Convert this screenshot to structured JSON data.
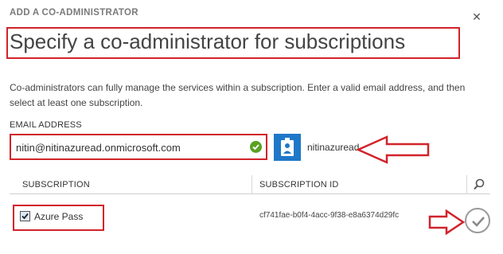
{
  "dialog": {
    "label": "ADD A CO-ADMINISTRATOR",
    "close_glyph": "✕",
    "title": "Specify a co-administrator for subscriptions",
    "description": "Co-administrators can fully manage the services within a subscription. Enter a valid email address, and then select at least one subscription."
  },
  "email": {
    "label": "EMAIL ADDRESS",
    "value": "nitin@nitinazuread.onmicrosoft.com",
    "valid_icon": "check-circle-icon",
    "resolved_user_name": "nitinazuread",
    "avatar_icon": "user-badge-icon"
  },
  "subscriptions": {
    "columns": [
      "SUBSCRIPTION",
      "SUBSCRIPTION ID"
    ],
    "search_icon": "search-icon",
    "rows": [
      {
        "name": "Azure Pass",
        "id": "cf741fae-b0f4-4acc-9f38-e8a6374d29fc",
        "checked": true
      }
    ]
  },
  "actions": {
    "confirm_icon": "checkmark-icon"
  },
  "colors": {
    "highlight": "#d2232a",
    "valid": "#5aa021",
    "avatar_bg": "#1e78c8"
  }
}
